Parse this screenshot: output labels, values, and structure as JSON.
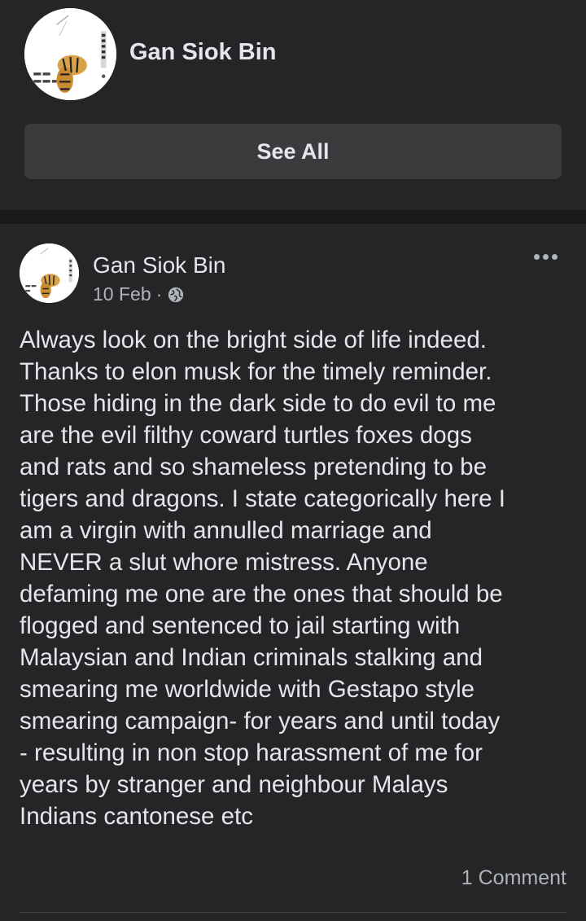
{
  "profile": {
    "name": "Gan Siok Bin",
    "see_all_label": "See All"
  },
  "post": {
    "author": "Gan Siok Bin",
    "date": "10 Feb",
    "separator": "·",
    "privacy_icon": "globe-icon",
    "more_icon": "more-options-icon",
    "text_lines": [
      "Always look on the bright side of life indeed.",
      "Thanks to elon musk for the timely reminder.",
      "Those hiding in the dark side to do evil to me",
      "are the evil filthy coward turtles foxes dogs",
      "and rats and so shameless pretending to be",
      "tigers and dragons. I state categorically here I",
      "am a virgin with annulled marriage and",
      "NEVER a slut whore mistress. Anyone",
      "defaming me  one are the ones that should be",
      "flogged and sentenced to jail starting with",
      "Malaysian and Indian criminals stalking and",
      "smearing me worldwide with Gestapo style",
      "smearing campaign- for years and until today",
      "- resulting in non stop harassment of me for",
      "years by stranger and neighbour Malays",
      "Indians cantonese etc"
    ],
    "comment_count_label": "1 Comment"
  },
  "colors": {
    "card_background": "#242526",
    "page_background": "#18191a",
    "button_background": "#3a3b3c",
    "primary_text": "#e4e6eb",
    "secondary_text": "#b0b3b8"
  }
}
